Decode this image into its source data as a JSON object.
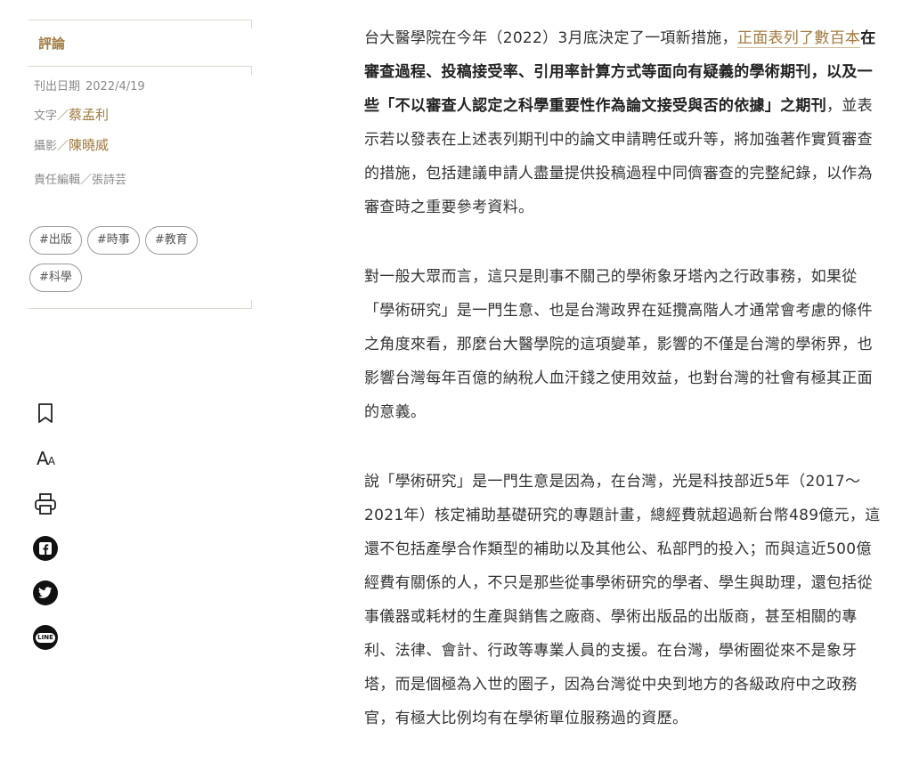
{
  "sidebar": {
    "category": "評論",
    "publish_label": "刊出日期",
    "publish_date": "2022/4/19",
    "author_label": "文字",
    "author_name": "蔡孟利",
    "photo_label": "攝影",
    "photo_name": "陳曉威",
    "editor": "責任編輯／張詩芸",
    "slash": "／",
    "tags": [
      "#出版",
      "#時事",
      "#教育",
      "#科學"
    ]
  },
  "actions": {
    "icons": [
      "bookmark-icon",
      "font-size-icon",
      "print-icon",
      "facebook-icon",
      "twitter-icon",
      "line-icon"
    ],
    "font_size_big": "A",
    "font_size_small": "A",
    "line_text": "LINE"
  },
  "article": {
    "p1_start": "台大醫學院在今年（2022）3月底決定了一項新措施，",
    "p1_link": "正面表列了數百本",
    "p1_bold": "在審查過程、投稿接受率、引用率計算方式等面向有疑義的學術期刊，以及一些「不以審查人認定之科學重要性作為論文接受與否的依據」之期刊",
    "p1_end": "，並表示若以發表在上述表列期刊中的論文申請聘任或升等，將加強著作實質審查的措施，包括建議申請人盡量提供投稿過程中同儕審查的完整紀錄，以作為審查時之重要參考資料。",
    "p2": "對一般大眾而言，這只是則事不關己的學術象牙塔內之行政事務，如果從「學術研究」是一門生意、也是台灣政界在延攬高階人才通常會考慮的條件之角度來看，那麼台大醫學院的這項變革，影響的不僅是台灣的學術界，也影響台灣每年百億的納稅人血汗錢之使用效益，也對台灣的社會有極其正面的意義。",
    "p3": "說「學術研究」是一門生意是因為，在台灣，光是科技部近5年（2017～2021年）核定補助基礎研究的專題計畫，總經費就超過新台幣489億元，這還不包括產學合作類型的補助以及其他公、私部門的投入；而與這近500億經費有關係的人，不只是那些從事學術研究的學者、學生與助理，還包括從事儀器或耗材的生產與銷售之廠商、學術出版品的出版商，甚至相關的專利、法律、會計、行政等專業人員的支援。在台灣，學術圈從來不是象牙塔，而是個極為入世的圈子，因為台灣從中央到地方的各級政府中之政務官，有極大比例均有在學術單位服務過的資歷。"
  },
  "colors": {
    "accent": "#a17a40",
    "text": "#333333",
    "muted": "#8a8a8a",
    "rule": "#ddd8cf"
  }
}
